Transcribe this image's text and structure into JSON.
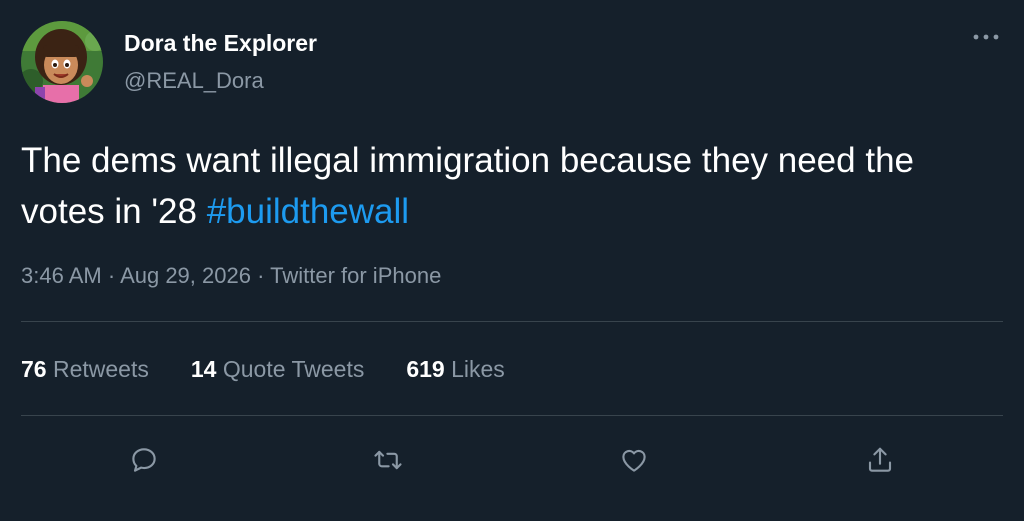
{
  "author": {
    "display_name": "Dora the Explorer",
    "handle": "@REAL_Dora"
  },
  "tweet": {
    "text": "The dems want illegal immigration because they need the votes in '28 ",
    "hashtag": "#buildthewall",
    "time": "3:46 AM",
    "date": "Aug 29, 2026",
    "source": "Twitter for iPhone",
    "separator": " · "
  },
  "stats": {
    "retweets": {
      "count": "76",
      "label": "Retweets"
    },
    "quote_tweets": {
      "count": "14",
      "label": "Quote Tweets"
    },
    "likes": {
      "count": "619",
      "label": "Likes"
    }
  },
  "actions": [
    "reply-icon",
    "retweet-icon",
    "like-icon",
    "share-icon"
  ],
  "colors": {
    "background": "#15202b",
    "text": "#ffffff",
    "secondary": "#8b98a5",
    "link": "#1d9bf0",
    "divider": "#38444d"
  }
}
